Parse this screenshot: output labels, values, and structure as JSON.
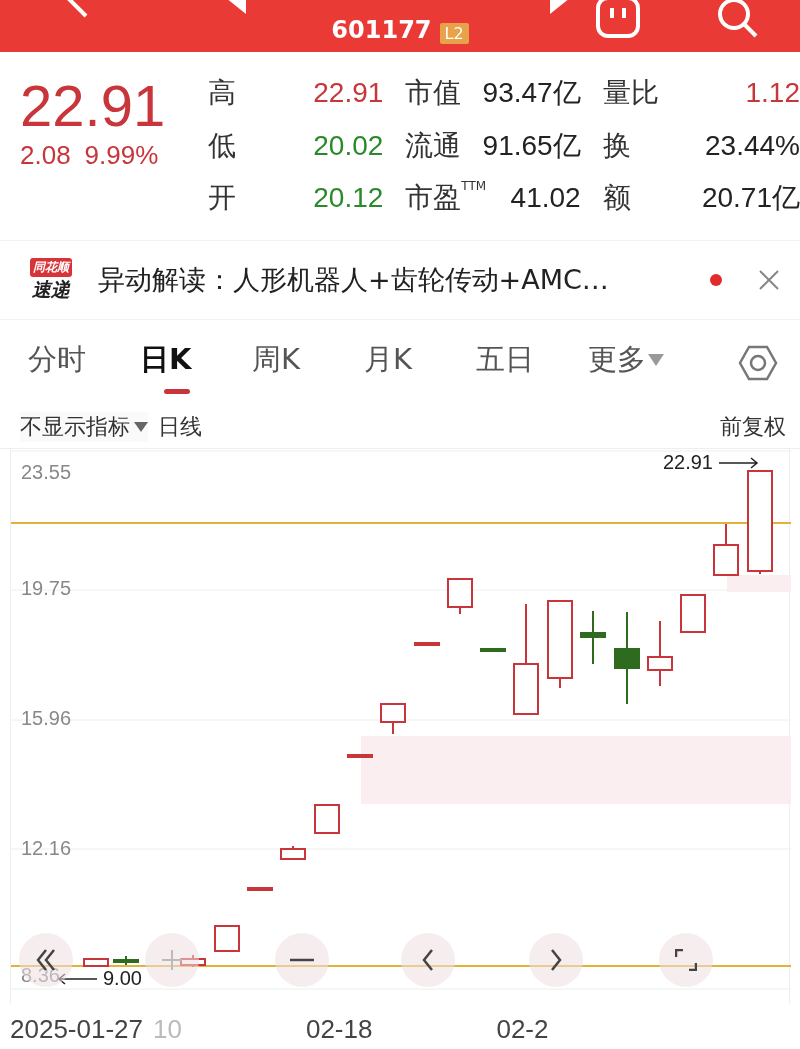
{
  "header": {
    "code": "601177",
    "badge": "L2"
  },
  "quote": {
    "price": "22.91",
    "change": "2.08",
    "change_pct": "9.99%",
    "stats": [
      {
        "label": "高",
        "value": "22.91",
        "color": "#c8353a"
      },
      {
        "label": "市值",
        "value": "93.47亿",
        "color": "#222222"
      },
      {
        "label": "量比",
        "value": "1.12",
        "color": "#c8353a"
      },
      {
        "label": "低",
        "value": "20.02",
        "color": "#2a8a2a"
      },
      {
        "label": "流通",
        "value": "91.65亿",
        "color": "#222222"
      },
      {
        "label": "换",
        "value": "23.44%",
        "color": "#222222"
      },
      {
        "label": "开",
        "value": "20.12",
        "color": "#2a8a2a"
      },
      {
        "label": "市盈$^{TTM}$",
        "value": "41.02",
        "color": "#222222"
      },
      {
        "label": "额",
        "value": "20.71亿",
        "color": "#222222"
      }
    ]
  },
  "news": {
    "logo_top": "同花顺",
    "logo_bottom": "速递",
    "text": "异动解读：人形机器人+齿轮传动+AMC…",
    "unread": true
  },
  "tabs": [
    {
      "label": "分时",
      "selected": false
    },
    {
      "label": "日K",
      "selected": true
    },
    {
      "label": "周K",
      "selected": false
    },
    {
      "label": "月K",
      "selected": false
    },
    {
      "label": "五日",
      "selected": false
    },
    {
      "label": "更多",
      "selected": false
    }
  ],
  "toolbar": {
    "indicator": "不显示指标",
    "line_type": "日线",
    "adjust": "前复权"
  },
  "chart": {
    "yticks": [
      "23.55",
      "19.75",
      "15.96",
      "12.16",
      "8.36"
    ],
    "high_marker": "22.91",
    "low_marker": "9.00",
    "xlabels": [
      {
        "label": "2025-01-27",
        "faded": false
      },
      {
        "label": "10",
        "faded": true
      },
      {
        "label": "02-18",
        "faded": false
      },
      {
        "label": "02-2",
        "faded": false
      }
    ]
  }
}
